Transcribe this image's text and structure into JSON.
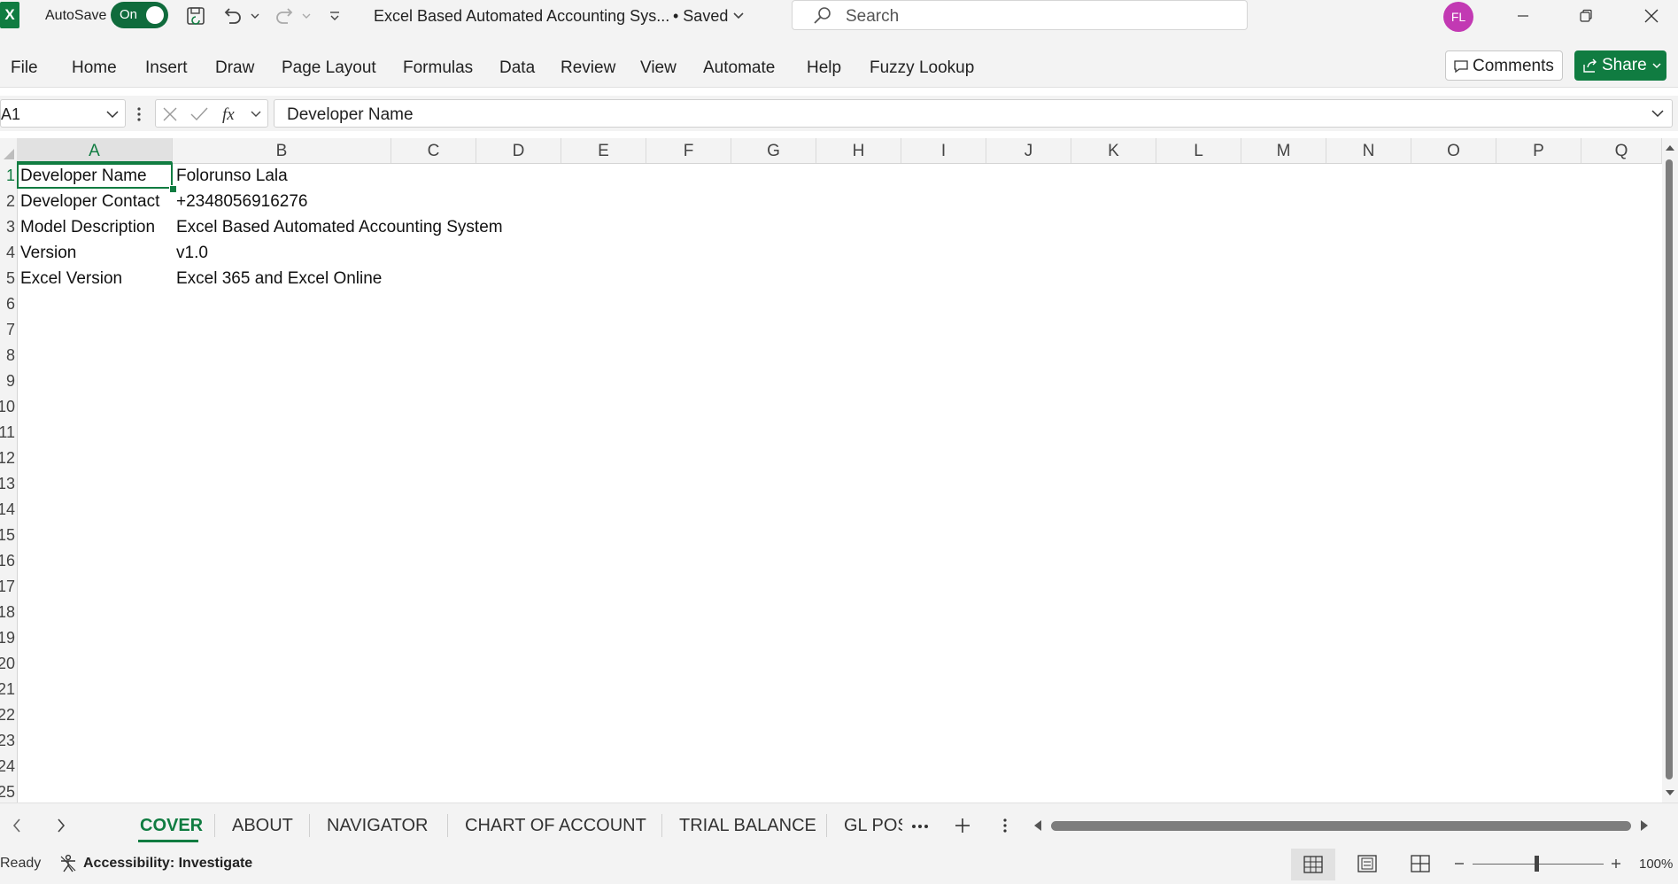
{
  "titlebar": {
    "app_logo": "X",
    "autosave_label": "AutoSave",
    "autosave_state": "On",
    "doc_title": "Excel Based Automated Accounting Sys...",
    "doc_status": "• Saved",
    "search_placeholder": "Search",
    "avatar_initials": "FL",
    "icons": [
      "save-icon",
      "undo-icon",
      "redo-icon",
      "customize-icon",
      "minimize-icon",
      "restore-icon",
      "close-icon"
    ]
  },
  "ribbon": {
    "tabs": [
      "File",
      "Home",
      "Insert",
      "Draw",
      "Page Layout",
      "Formulas",
      "Data",
      "Review",
      "View",
      "Automate",
      "Help",
      "Fuzzy Lookup"
    ],
    "comments_label": "Comments",
    "share_label": "Share"
  },
  "formula_bar": {
    "name_box": "A1",
    "formula": "Developer Name"
  },
  "grid": {
    "columns": [
      "A",
      "B",
      "C",
      "D",
      "E",
      "F",
      "G",
      "H",
      "I",
      "J",
      "K",
      "L",
      "M",
      "N",
      "O",
      "P",
      "Q"
    ],
    "selected_column": "A",
    "row_labels": [
      "1",
      "2",
      "3",
      "4",
      "5",
      "6",
      "7",
      "8",
      "9",
      "10",
      "11",
      "12",
      "13",
      "14",
      "15",
      "16",
      "17",
      "18",
      "19",
      "20",
      "21",
      "22",
      "23",
      "24",
      "25"
    ],
    "rows": [
      {
        "a": "Developer Name",
        "b": "Folorunso Lala"
      },
      {
        "a": "Developer Contact",
        "b": "+2348056916276"
      },
      {
        "a": "Model Description",
        "b": "Excel Based Automated Accounting System"
      },
      {
        "a": "Version",
        "b": "v1.0"
      },
      {
        "a": "Excel Version",
        "b": "Excel 365 and Excel Online"
      }
    ]
  },
  "sheets": {
    "tabs": [
      "COVER",
      "ABOUT",
      "NAVIGATOR",
      "CHART OF ACCOUNT",
      "TRIAL BALANCE",
      "GL POS"
    ],
    "active": "COVER"
  },
  "statusbar": {
    "ready": "Ready",
    "accessibility": "Accessibility: Investigate",
    "zoom": "100%"
  },
  "colors": {
    "accent": "#107c41",
    "avatar": "#c239b3"
  }
}
